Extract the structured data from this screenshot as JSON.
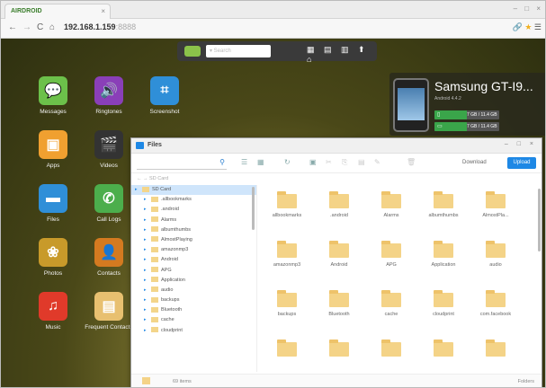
{
  "browser": {
    "tab_title": "AIRDROID",
    "tab_close": "×",
    "window_controls": "– □ ×",
    "url": "192.168.1.159",
    "url_port": ":8888"
  },
  "toolbar": {
    "search_placeholder": "▾ Search",
    "icons": "▦ ▤ ▥ ⬆ ⌂"
  },
  "apps": [
    {
      "label": "Messages",
      "icon": "chat-icon",
      "color": "#6cc04a",
      "glyph": "💬"
    },
    {
      "label": "Ringtones",
      "icon": "speaker-icon",
      "color": "#8a3fb8",
      "glyph": "🔊"
    },
    {
      "label": "Screenshot",
      "icon": "crop-icon",
      "color": "#2f8fd8",
      "glyph": "⌗"
    },
    {
      "label": "Apps",
      "icon": "package-icon",
      "color": "#f0a030",
      "glyph": "▣"
    },
    {
      "label": "Videos",
      "icon": "clapper-icon",
      "color": "#333333",
      "glyph": "🎬"
    },
    {
      "label": "Files",
      "icon": "folder-icon",
      "color": "#2f8fd8",
      "glyph": "▬"
    },
    {
      "label": "Call Logs",
      "icon": "phone-icon",
      "color": "#4cae4c",
      "glyph": "✆"
    },
    {
      "label": "Photos",
      "icon": "photo-icon",
      "color": "#c89a2a",
      "glyph": "❀"
    },
    {
      "label": "Contacts",
      "icon": "contact-icon",
      "color": "#d47a20",
      "glyph": "👤"
    },
    {
      "label": "Music",
      "icon": "music-icon",
      "color": "#e03a2a",
      "glyph": "♫"
    },
    {
      "label": "Frequent Contacts",
      "icon": "frequent-contacts-icon",
      "color": "#e8c070",
      "glyph": "▤"
    }
  ],
  "device": {
    "name": "Samsung GT-I9...",
    "subtitle": "Android 4.4.2",
    "storage": [
      {
        "icon": "phone-storage-icon",
        "glyph": "▯",
        "text": "7 GB / 11.4 GB",
        "fill": 0.5
      },
      {
        "icon": "sd-card-icon",
        "glyph": "▭",
        "text": "7 GB / 11.4 GB",
        "fill": 0.5
      }
    ]
  },
  "files_window": {
    "title": "Files",
    "controls": "– □ ×",
    "search_placeholder": "",
    "download_label": "Download",
    "upload_label": "Upload",
    "breadcrumb": "←  →  SD Card",
    "tree": [
      {
        "name": "SD Card",
        "selected": true
      },
      {
        "name": ".allbookmarks"
      },
      {
        "name": ".android"
      },
      {
        "name": "Alarms"
      },
      {
        "name": "albumthumbs"
      },
      {
        "name": "AlmostPlaying"
      },
      {
        "name": "amazonmp3"
      },
      {
        "name": "Android"
      },
      {
        "name": "APG"
      },
      {
        "name": "Application"
      },
      {
        "name": "audio"
      },
      {
        "name": "backups"
      },
      {
        "name": "Bluetooth"
      },
      {
        "name": "cache"
      },
      {
        "name": "cloudprint"
      }
    ],
    "folders": [
      "allbookmarks",
      ".android",
      "Alarms",
      "albumthumbs",
      "AlmostPla...",
      "amazonmp3",
      "Android",
      "APG",
      "Application",
      "audio",
      "backups",
      "Bluetooth",
      "cache",
      "cloudprint",
      "com.facebook",
      "",
      "",
      "",
      "",
      ""
    ],
    "status_count": "69 items",
    "status_right": "Folders"
  }
}
